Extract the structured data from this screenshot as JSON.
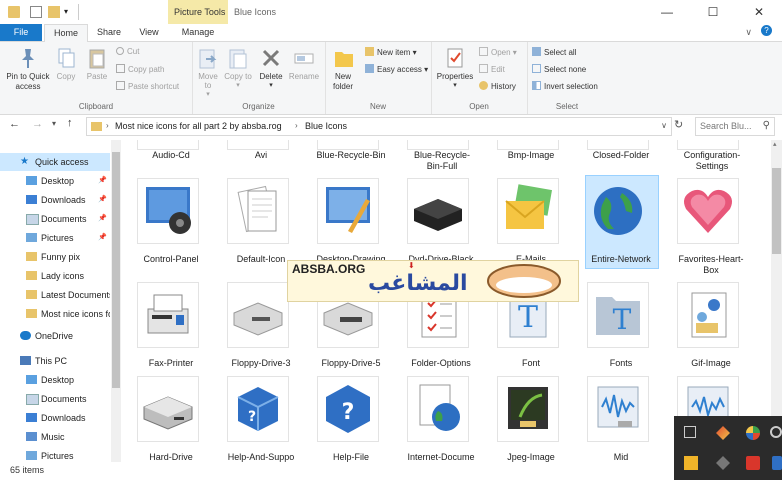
{
  "window": {
    "title": "Blue Icons",
    "context_tab": "Picture Tools",
    "minimize": "—",
    "maximize": "☐",
    "close": "✕"
  },
  "tabs": [
    "File",
    "Home",
    "Share",
    "View",
    "Manage"
  ],
  "ribbon": {
    "clipboard": {
      "label": "Clipboard",
      "pin": "Pin to Quick access",
      "copy": "Copy",
      "paste": "Paste",
      "cut": "Cut",
      "copy_path": "Copy path",
      "paste_shortcut": "Paste shortcut"
    },
    "organize": {
      "label": "Organize",
      "move_to": "Move to",
      "copy_to": "Copy to",
      "delete": "Delete",
      "rename": "Rename"
    },
    "new": {
      "label": "New",
      "new_folder": "New folder",
      "new_item": "New item ▾",
      "easy_access": "Easy access ▾"
    },
    "open": {
      "label": "Open",
      "properties": "Properties",
      "open": "Open ▾",
      "edit": "Edit",
      "history": "History"
    },
    "select": {
      "label": "Select",
      "select_all": "Select all",
      "select_none": "Select none",
      "invert": "Invert selection"
    }
  },
  "address": {
    "path": [
      "Most nice icons for all part 2 by absba.rog",
      "Blue Icons"
    ],
    "search_placeholder": "Search Blu..."
  },
  "nav": {
    "quick_access": "Quick access",
    "items": [
      {
        "label": "Desktop",
        "pinned": true
      },
      {
        "label": "Downloads",
        "pinned": true
      },
      {
        "label": "Documents",
        "pinned": true
      },
      {
        "label": "Pictures",
        "pinned": true
      },
      {
        "label": "Funny pix",
        "pinned": false
      },
      {
        "label": "Lady icons",
        "pinned": false
      },
      {
        "label": "Latest Documents",
        "pinned": false
      },
      {
        "label": "Most nice icons for",
        "pinned": false
      }
    ],
    "onedrive": "OneDrive",
    "this_pc": "This PC",
    "pc_items": [
      "Desktop",
      "Documents",
      "Downloads",
      "Music",
      "Pictures"
    ]
  },
  "files_row0": [
    "Audio-Cd",
    "Avi",
    "Blue-Recycle-Bin",
    "Blue-Recycle-Bin-Full",
    "Bmp-Image",
    "Closed-Folder",
    "Configuration-Settings"
  ],
  "files_row1": [
    "Control-Panel",
    "Default-Icon",
    "Desktop-Drawing",
    "Dvd-Drive-Black",
    "E-Mails",
    "Entire-Network",
    "Favorites-Heart-Box"
  ],
  "files_row2": [
    "Fax-Printer",
    "Floppy-Drive-3",
    "Floppy-Drive-5",
    "Folder-Options",
    "Font",
    "Fonts",
    "Gif-Image"
  ],
  "files_row3": [
    "Hard-Drive",
    "Help-And-Suppo",
    "Help-File",
    "Internet-Docume",
    "Jpeg-Image",
    "Mid",
    ""
  ],
  "selected_file": "Entire-Network",
  "status": "65 items",
  "watermark": {
    "site": "ABSBA.ORG",
    "arabic": "المشاغب"
  },
  "colors": {
    "accent": "#1979ca",
    "selection": "#cce8ff",
    "context_tab": "#f5e9a8"
  }
}
